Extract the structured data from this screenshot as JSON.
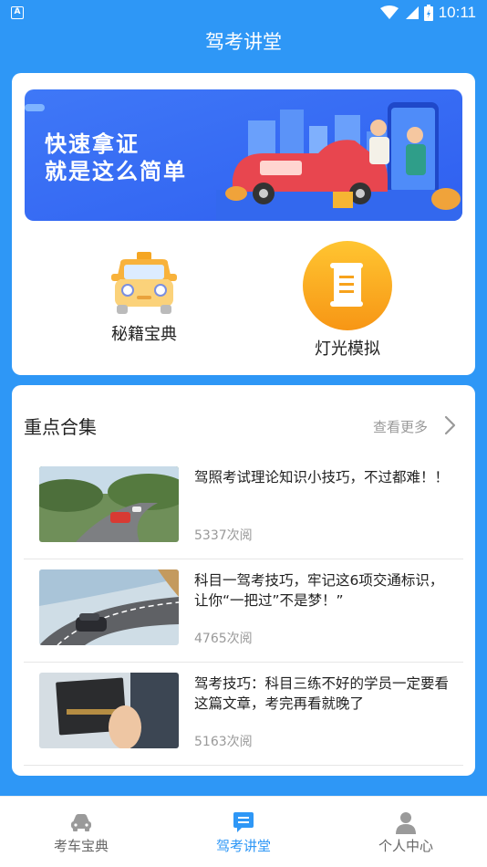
{
  "status_bar": {
    "time": "10:11",
    "notification_letter": "A"
  },
  "app_title": "驾考讲堂",
  "banner": {
    "line1": "快速拿证",
    "line2": "就是这么简单"
  },
  "features": [
    {
      "label": "秘籍宝典",
      "icon": "taxi-icon"
    },
    {
      "label": "灯光模拟",
      "icon": "scroll-icon"
    }
  ],
  "section": {
    "title": "重点合集",
    "more": "查看更多"
  },
  "articles": [
    {
      "title": "驾照考试理论知识小技巧，不过都难！！",
      "views": "5337次阅"
    },
    {
      "title": "科目一驾考技巧，牢记这6项交通标识，让你“一把过”不是梦！”",
      "views": "4765次阅"
    },
    {
      "title": "驾考技巧：科目三练不好的学员一定要看这篇文章，考完再看就晚了",
      "views": "5163次阅"
    }
  ],
  "bottom_nav": [
    {
      "label": "考车宝典",
      "icon": "car-icon",
      "active": false
    },
    {
      "label": "驾考讲堂",
      "icon": "chat-icon",
      "active": true
    },
    {
      "label": "个人中心",
      "icon": "person-icon",
      "active": false
    }
  ],
  "colors": {
    "primary": "#2e97f6",
    "banner": "#3b6ef5",
    "accent_orange": "#f8a21a"
  }
}
